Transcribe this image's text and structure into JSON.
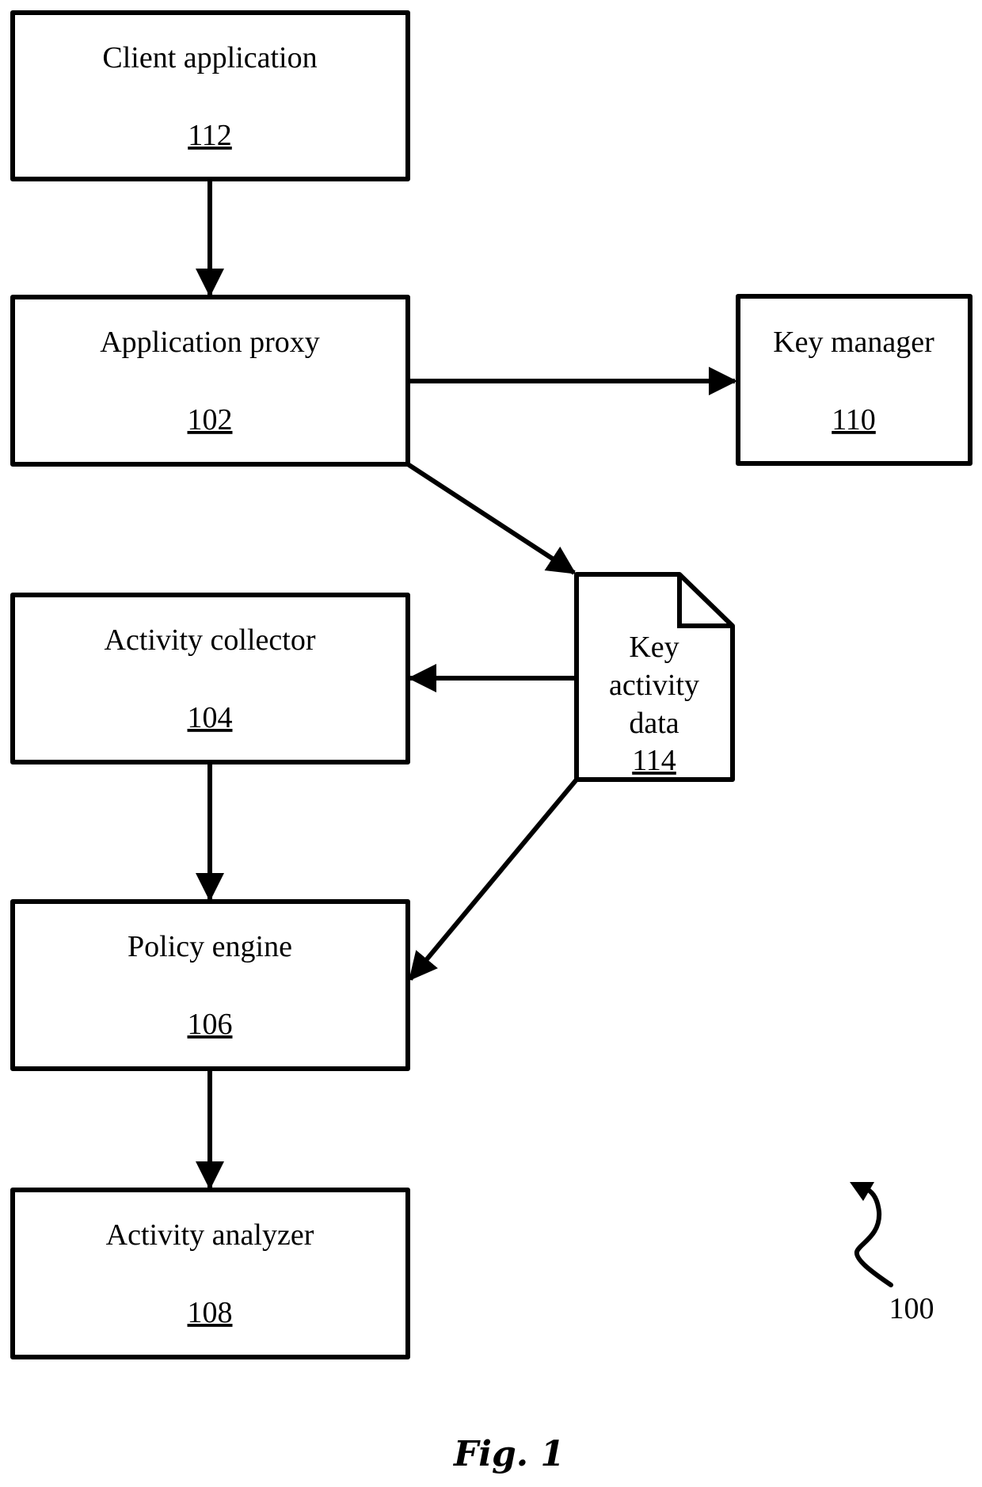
{
  "figure": {
    "caption": "Fig. 1",
    "reference_numeral": "100"
  },
  "nodes": {
    "client_application": {
      "label": "Client application",
      "ref": "112"
    },
    "application_proxy": {
      "label": "Application proxy",
      "ref": "102"
    },
    "key_manager": {
      "label": "Key manager",
      "ref": "110"
    },
    "activity_collector": {
      "label": "Activity collector",
      "ref": "104"
    },
    "policy_engine": {
      "label": "Policy engine",
      "ref": "106"
    },
    "activity_analyzer": {
      "label": "Activity analyzer",
      "ref": "108"
    },
    "key_activity_data": {
      "label_lines": [
        "Key",
        "activity",
        "data"
      ],
      "ref": "114"
    }
  },
  "edges": [
    {
      "from": "client_application",
      "to": "application_proxy"
    },
    {
      "from": "application_proxy",
      "to": "key_manager"
    },
    {
      "from": "application_proxy",
      "to": "key_activity_data"
    },
    {
      "from": "key_activity_data",
      "to": "activity_collector"
    },
    {
      "from": "key_activity_data",
      "to": "policy_engine"
    },
    {
      "from": "activity_collector",
      "to": "policy_engine"
    },
    {
      "from": "policy_engine",
      "to": "activity_analyzer"
    }
  ]
}
